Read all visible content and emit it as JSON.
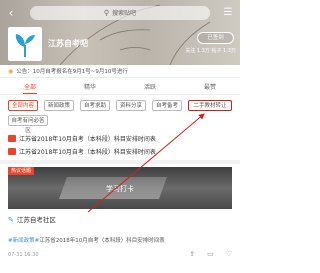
{
  "header": {
    "search_placeholder": "搜索贴吧",
    "bar_title": "江苏自考吧",
    "sign_label": "已签到",
    "stats": "关注 1.3万  帖子 1.3万"
  },
  "notice": {
    "text": "公告：10月自考报名在9月1号~9月10号进行"
  },
  "tabs": [
    {
      "label": "全部",
      "active": true
    },
    {
      "label": "精华",
      "active": false
    },
    {
      "label": "活跃",
      "active": false
    },
    {
      "label": "最赞",
      "active": false
    }
  ],
  "chips": [
    {
      "label": "全部内容",
      "active": true
    },
    {
      "label": "新闻政策"
    },
    {
      "label": "自考求助"
    },
    {
      "label": "资料分享"
    },
    {
      "label": "自考备考"
    },
    {
      "label": "二手教材转让",
      "highlighted": true
    },
    {
      "label": "自考有问必答区"
    }
  ],
  "pinned_posts": [
    {
      "text": "江苏省2018年10月自考（本科段）科目安排时间表"
    },
    {
      "text": "江苏省2018年10月自考（本科段）科目安排时间表"
    }
  ],
  "feature": {
    "tag": "热议话题",
    "label": "学习打卡"
  },
  "post": {
    "author": "江苏自考社区",
    "hashtag": "#新闻政策#",
    "title": "江苏省2018年10月自考（本科段）科目安排时间表",
    "meta": "07-31  16:30"
  },
  "colors": {
    "accent": "#e8452c",
    "link": "#3a8ee6",
    "annotation": "#d02020"
  }
}
